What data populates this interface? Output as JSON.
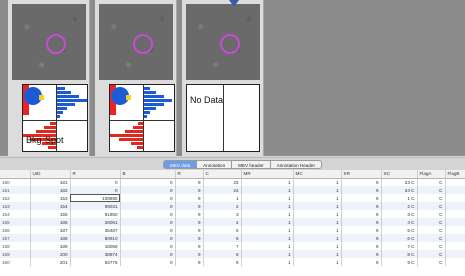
{
  "spots": [
    {
      "kind": "histogram",
      "label_left": "Bkg",
      "label_right": "Spot"
    },
    {
      "kind": "histogram",
      "label_left": "",
      "label_right": ""
    },
    {
      "kind": "nodata",
      "nodata_text": "No Data"
    }
  ],
  "tabs": [
    {
      "label": "MEV data",
      "active": true
    },
    {
      "label": "Annotation",
      "active": false
    },
    {
      "label": "MEV header",
      "active": false
    },
    {
      "label": "Annotation Header",
      "active": false
    }
  ],
  "table": {
    "columns": [
      "",
      "UID",
      "R",
      "B",
      "R",
      "C",
      "MR",
      "MC",
      "SR",
      "SC",
      "FlagA",
      "FlagB"
    ],
    "rows": [
      [
        "150",
        "181",
        "0",
        "0",
        "9",
        "23",
        "1",
        "1",
        "9",
        "23 C",
        "C",
        ""
      ],
      [
        "151",
        "182",
        "0",
        "0",
        "9",
        "24",
        "1",
        "1",
        "9",
        "24 C",
        "C",
        ""
      ],
      [
        "152",
        "153",
        "108890",
        "0",
        "9",
        "1",
        "1",
        "1",
        "9",
        "1 C",
        "C",
        ""
      ],
      [
        "153",
        "154",
        "99031",
        "0",
        "9",
        "2",
        "1",
        "1",
        "9",
        "2 C",
        "C",
        ""
      ],
      [
        "154",
        "155",
        "81850",
        "0",
        "9",
        "3",
        "1",
        "1",
        "9",
        "3 C",
        "C",
        ""
      ],
      [
        "155",
        "186",
        "28061",
        "0",
        "9",
        "4",
        "1",
        "1",
        "9",
        "4 C",
        "C",
        ""
      ],
      [
        "156",
        "187",
        "35487",
        "0",
        "9",
        "5",
        "1",
        "1",
        "9",
        "5 C",
        "C",
        ""
      ],
      [
        "157",
        "188",
        "80910",
        "0",
        "9",
        "6",
        "1",
        "1",
        "9",
        "6 C",
        "C",
        ""
      ],
      [
        "158",
        "189",
        "18058",
        "0",
        "9",
        "7",
        "1",
        "1",
        "9",
        "7 C",
        "C",
        ""
      ],
      [
        "159",
        "200",
        "38874",
        "0",
        "9",
        "8",
        "1",
        "1",
        "9",
        "8 C",
        "C",
        ""
      ],
      [
        "160",
        "201",
        "83775",
        "0",
        "9",
        "9",
        "1",
        "1",
        "9",
        "9 C",
        "C",
        ""
      ]
    ]
  }
}
